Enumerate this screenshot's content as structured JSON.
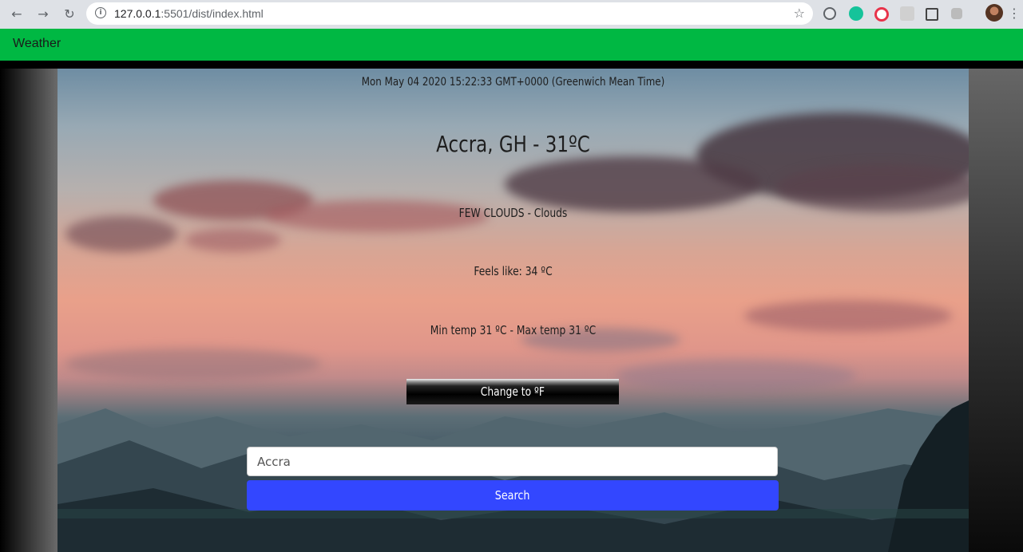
{
  "browser": {
    "url_host": "127.0.0.1",
    "url_path": ":5501/dist/index.html",
    "back_icon": "arrow-left-icon",
    "forward_icon": "arrow-right-icon",
    "reload_icon": "reload-icon",
    "bookmark_icon": "star-icon"
  },
  "navbar": {
    "brand": "Weather",
    "color": "#00b843"
  },
  "weather": {
    "datetime": "Mon May 04 2020 15:22:33 GMT+0000 (Greenwich Mean Time)",
    "location": "Accra, GH - 31ºC",
    "description": "FEW CLOUDS - Clouds",
    "feels_like": "Feels like: 34 ºC",
    "min_max": "Min temp 31 ºC - Max temp 31 ºC"
  },
  "controls": {
    "change_unit_label": "Change to ºF",
    "search_value": "Accra",
    "search_label": "Search",
    "search_color": "#3347ff"
  }
}
